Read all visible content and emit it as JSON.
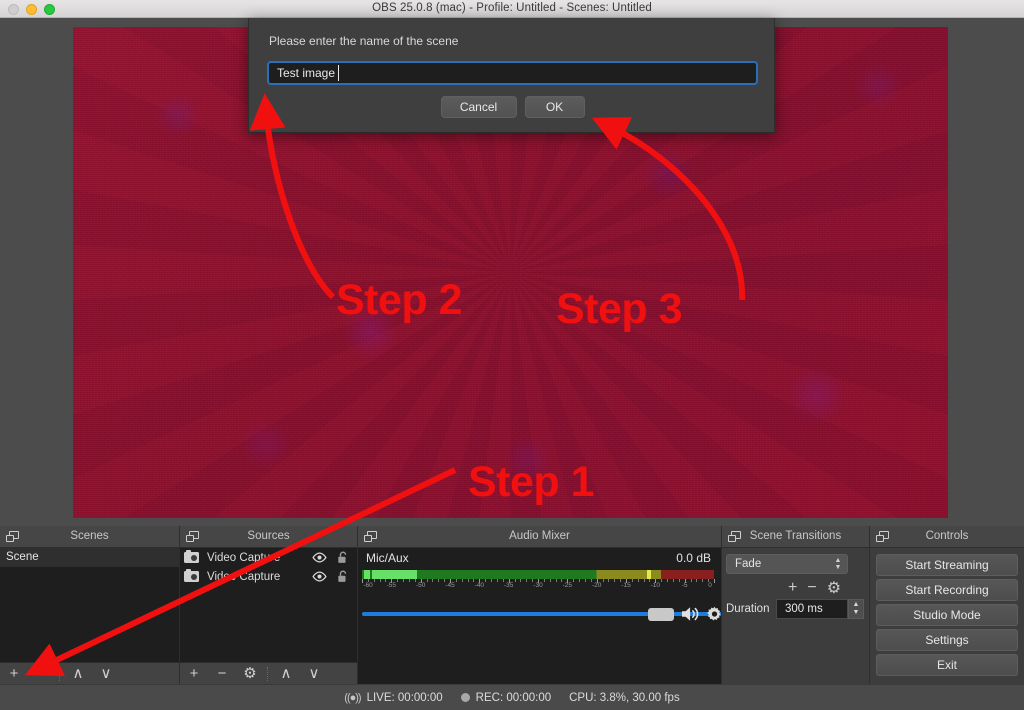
{
  "window": {
    "title": "OBS 25.0.8 (mac) - Profile: Untitled - Scenes: Untitled",
    "traffic_lights": [
      "close-disabled",
      "minimize",
      "zoom"
    ]
  },
  "dialog": {
    "prompt": "Please enter the name of the scene",
    "input_value": "Test image",
    "input_placeholder": "",
    "cancel_label": "Cancel",
    "ok_label": "OK",
    "focus_color": "#2a6fb8"
  },
  "annotations": {
    "accent_color": "#f01010",
    "step1": "Step 1",
    "step2": "Step 2",
    "step3": "Step 3"
  },
  "panels": {
    "scenes": {
      "title": "Scenes",
      "items": [
        {
          "label": "Scene",
          "selected": true
        }
      ],
      "toolbar": [
        {
          "name": "add-scene",
          "glyph": "+"
        },
        {
          "name": "remove-scene",
          "glyph": "−"
        },
        {
          "name": "separator",
          "glyph": ""
        },
        {
          "name": "move-scene-up",
          "glyph": "∧"
        },
        {
          "name": "move-scene-down",
          "glyph": "∨"
        }
      ]
    },
    "sources": {
      "title": "Sources",
      "items": [
        {
          "label": "Video Capture",
          "visible": true,
          "locked": false
        },
        {
          "label": "Video Capture",
          "visible": true,
          "locked": false
        }
      ],
      "toolbar": [
        {
          "name": "add-source",
          "glyph": "+"
        },
        {
          "name": "remove-source",
          "glyph": "−"
        },
        {
          "name": "source-properties",
          "glyph": "⚙"
        },
        {
          "name": "separator",
          "glyph": ""
        },
        {
          "name": "move-source-up",
          "glyph": "∧"
        },
        {
          "name": "move-source-down",
          "glyph": "∨"
        }
      ]
    },
    "audio_mixer": {
      "title": "Audio Mixer",
      "channel_name": "Mic/Aux",
      "level_db": "0.0 dB",
      "scale_labels": [
        "-60",
        "-55",
        "-50",
        "-45",
        "-40",
        "-35",
        "-30",
        "-25",
        "-20",
        "-15",
        "-10",
        "-5",
        "0"
      ],
      "scale_min": -60,
      "scale_max": 0,
      "volume_percent": 100
    },
    "scene_transitions": {
      "title": "Scene Transitions",
      "transition": "Fade",
      "tools": [
        {
          "name": "add-transition",
          "glyph": "+"
        },
        {
          "name": "remove-transition",
          "glyph": "−"
        },
        {
          "name": "transition-properties",
          "glyph": "⚙"
        }
      ],
      "duration_label": "Duration",
      "duration_value": "300 ms"
    },
    "controls": {
      "title": "Controls",
      "buttons": [
        "Start Streaming",
        "Start Recording",
        "Studio Mode",
        "Settings",
        "Exit"
      ]
    }
  },
  "status_bar": {
    "live": "LIVE: 00:00:00",
    "rec": "REC: 00:00:00",
    "cpu": "CPU: 3.8%, 30.00 fps"
  }
}
